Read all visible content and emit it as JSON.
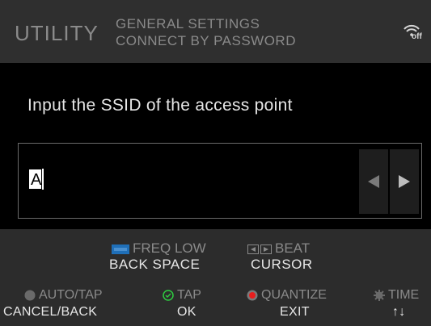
{
  "header": {
    "title": "UTILITY",
    "crumb_line1": "GENERAL SETTINGS",
    "crumb_line2": "CONNECT BY PASSWORD",
    "wifi_status": "off"
  },
  "main": {
    "prompt": "Input the SSID of the access point",
    "input_value": "A"
  },
  "footer": {
    "freq_low_label": "FREQ LOW",
    "freq_low_action": "BACK SPACE",
    "beat_label": "BEAT",
    "beat_action": "CURSOR",
    "auto_tap_label": "AUTO/TAP",
    "auto_tap_action": "CANCEL/BACK",
    "tap_label": "TAP",
    "tap_action": "OK",
    "quantize_label": "QUANTIZE",
    "quantize_action": "EXIT",
    "time_label": "TIME",
    "time_action": "↑↓"
  },
  "colors": {
    "header_bg": "#2f2f2f",
    "footer_bg": "#2c2c2c",
    "dim_text": "#8a8a8a",
    "bright_text": "#e6e6e6",
    "freq_icon": "#1f6fb8",
    "tap_icon": "#2ecc40",
    "quantize_icon": "#e81e1e"
  },
  "icons": [
    "wifi-off-icon",
    "arrow-left-icon",
    "arrow-right-icon",
    "freq-low-icon",
    "beat-icon",
    "auto-tap-icon",
    "tap-icon",
    "quantize-icon",
    "time-icon"
  ]
}
